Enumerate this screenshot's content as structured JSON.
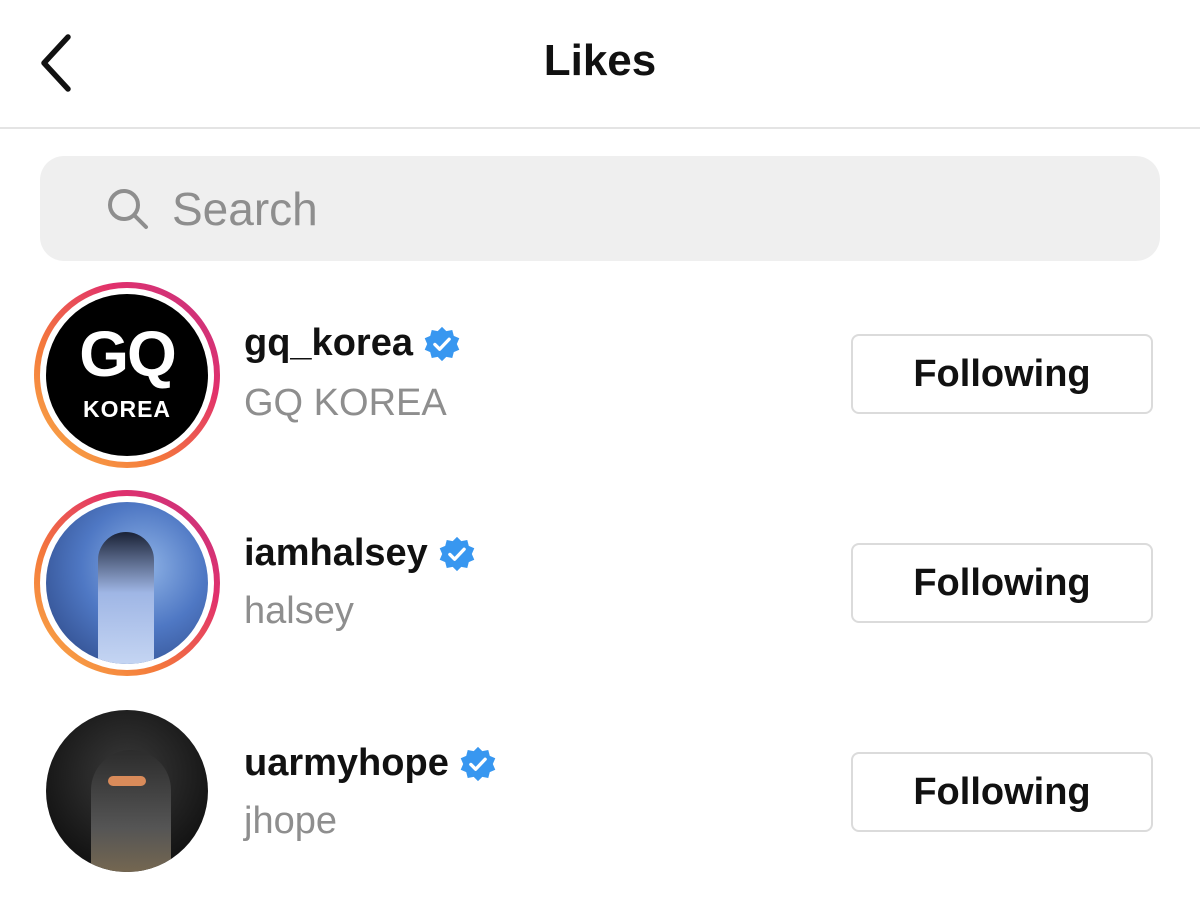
{
  "header": {
    "title": "Likes",
    "back_icon": "chevron-left-icon"
  },
  "search": {
    "placeholder": "Search",
    "value": "",
    "icon": "search-icon"
  },
  "users": [
    {
      "username": "gq_korea",
      "full_name": "GQ KOREA",
      "verified": true,
      "story_ring": true,
      "button_label": "Following",
      "avatar": {
        "logo_text": "GQ",
        "logo_subtext": "KOREA"
      }
    },
    {
      "username": "iamhalsey",
      "full_name": "halsey",
      "verified": true,
      "story_ring": true,
      "button_label": "Following"
    },
    {
      "username": "uarmyhope",
      "full_name": "jhope",
      "verified": true,
      "story_ring": false,
      "button_label": "Following"
    }
  ],
  "colors": {
    "verified_badge": "#3897f0",
    "secondary_text": "#8e8e8e",
    "search_background": "#efefef",
    "button_border": "#dbdbdb"
  }
}
